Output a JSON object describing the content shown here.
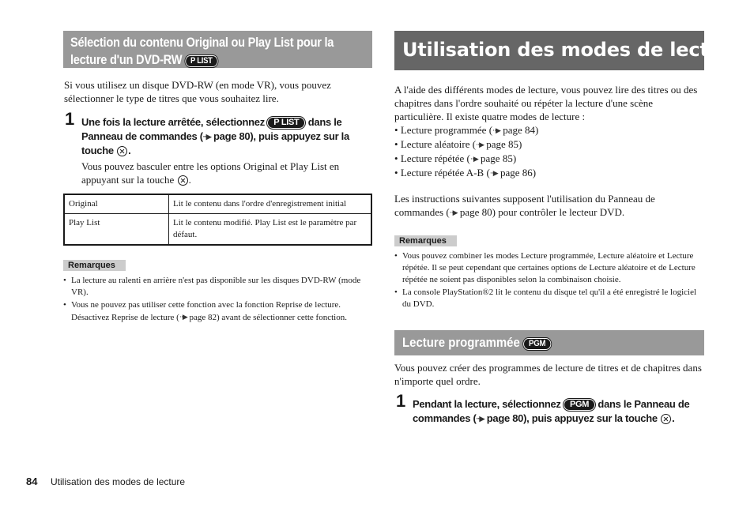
{
  "left": {
    "heading": {
      "line1": "Sélection du contenu Original ou Play List pour la",
      "line2": "lecture d'un DVD-RW",
      "badge": "P LIST"
    },
    "intro": "Si vous utilisez un disque DVD-RW (en mode VR), vous pouvez sélectionner le type de titres que vous souhaitez lire.",
    "step1": {
      "number": "1",
      "part1": "Une fois la lecture arrêtée, sélectionnez",
      "badge": "P LIST",
      "part2": "dans le Panneau de commandes (",
      "ref": "page 80), puis appuyez sur la touche",
      "end": ".",
      "note_part1": "Vous pouvez basculer entre les options Original et Play List en appuyant sur la touche",
      "note_end": "."
    },
    "table": {
      "rows": [
        {
          "option": "Original",
          "description": "Lit le contenu dans l'ordre d'enregistrement initial"
        },
        {
          "option": "Play List",
          "description": "Lit le contenu modifié. Play List est le paramètre par défaut."
        }
      ]
    },
    "remarks": {
      "label": "Remarques",
      "items": [
        {
          "text": "La lecture au ralenti en arrière n'est pas disponible sur les disques DVD-RW (mode VR)."
        },
        {
          "pre": "Vous ne pouvez pas utiliser cette fonction avec la fonction Reprise de lecture. Désactivez Reprise de lecture (",
          "post": " page 82) avant de sélectionner cette fonction."
        }
      ]
    }
  },
  "right": {
    "heading": "Utilisation des modes de lecture",
    "intro": "A l'aide des différents modes de lecture, vous pouvez lire des titres ou des chapitres dans l'ordre souhaité ou répéter la lecture d'une scène particulière. Il existe quatre modes de lecture :",
    "modes": [
      {
        "name": "Lecture programmée (",
        "ref": " page 84)"
      },
      {
        "name": "Lecture aléatoire (",
        "ref": " page 85)"
      },
      {
        "name": "Lecture répétée (",
        "ref": " page 85)"
      },
      {
        "name": "Lecture répétée A-B (",
        "ref": " page 86)"
      }
    ],
    "instructions_pre": "Les instructions suivantes supposent l'utilisation du Panneau de commandes (",
    "instructions_post": " page 80) pour contrôler le lecteur DVD.",
    "remarks": {
      "label": "Remarques",
      "items": [
        "Vous pouvez combiner les modes Lecture programmée, Lecture aléatoire et Lecture répétée. Il se peut cependant que certaines options de Lecture aléatoire et de Lecture répétée ne soient pas disponibles selon la combinaison choisie.",
        "La console PlayStation®2 lit le contenu du disque tel qu'il a été enregistré le logiciel du DVD."
      ]
    },
    "subsection": {
      "heading": "Lecture programmée",
      "badge": "PGM",
      "intro": "Vous pouvez créer des programmes de lecture de titres et de chapitres dans n'importe quel ordre.",
      "step1": {
        "number": "1",
        "part1": "Pendant la lecture, sélectionnez",
        "badge": "PGM",
        "part2": "dans le Panneau de commandes (",
        "ref": "page 80), puis appuyez sur la touche",
        "end": "."
      }
    }
  },
  "footer": {
    "page_number": "84",
    "title": "Utilisation des modes de lecture"
  },
  "icons": {
    "cross": "cross-button-icon",
    "arrow": "page-reference-arrow-icon"
  }
}
